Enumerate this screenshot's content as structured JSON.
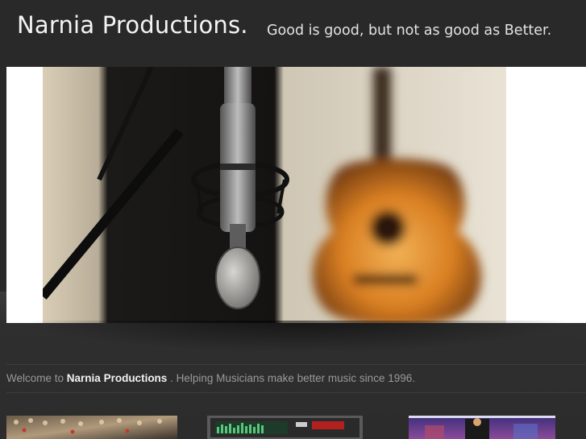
{
  "header": {
    "title": "Narnia Productions.",
    "tagline": "Good is good, but not as good as Better."
  },
  "welcome": {
    "prefix": "Welcome to",
    "brand": "Narnia Productions",
    "suffix": ". Helping Musicians make better music since 1996."
  },
  "colors": {
    "background": "#2b2b2b",
    "title_text": "#f4f4f4",
    "body_text": "#9a9a9a"
  },
  "hero": {
    "icon": "studio-microphone-guitar-photo"
  },
  "thumbnails": [
    {
      "icon": "mixing-console-photo"
    },
    {
      "icon": "audio-rack-unit-photo"
    },
    {
      "icon": "stage-performance-photo"
    }
  ]
}
